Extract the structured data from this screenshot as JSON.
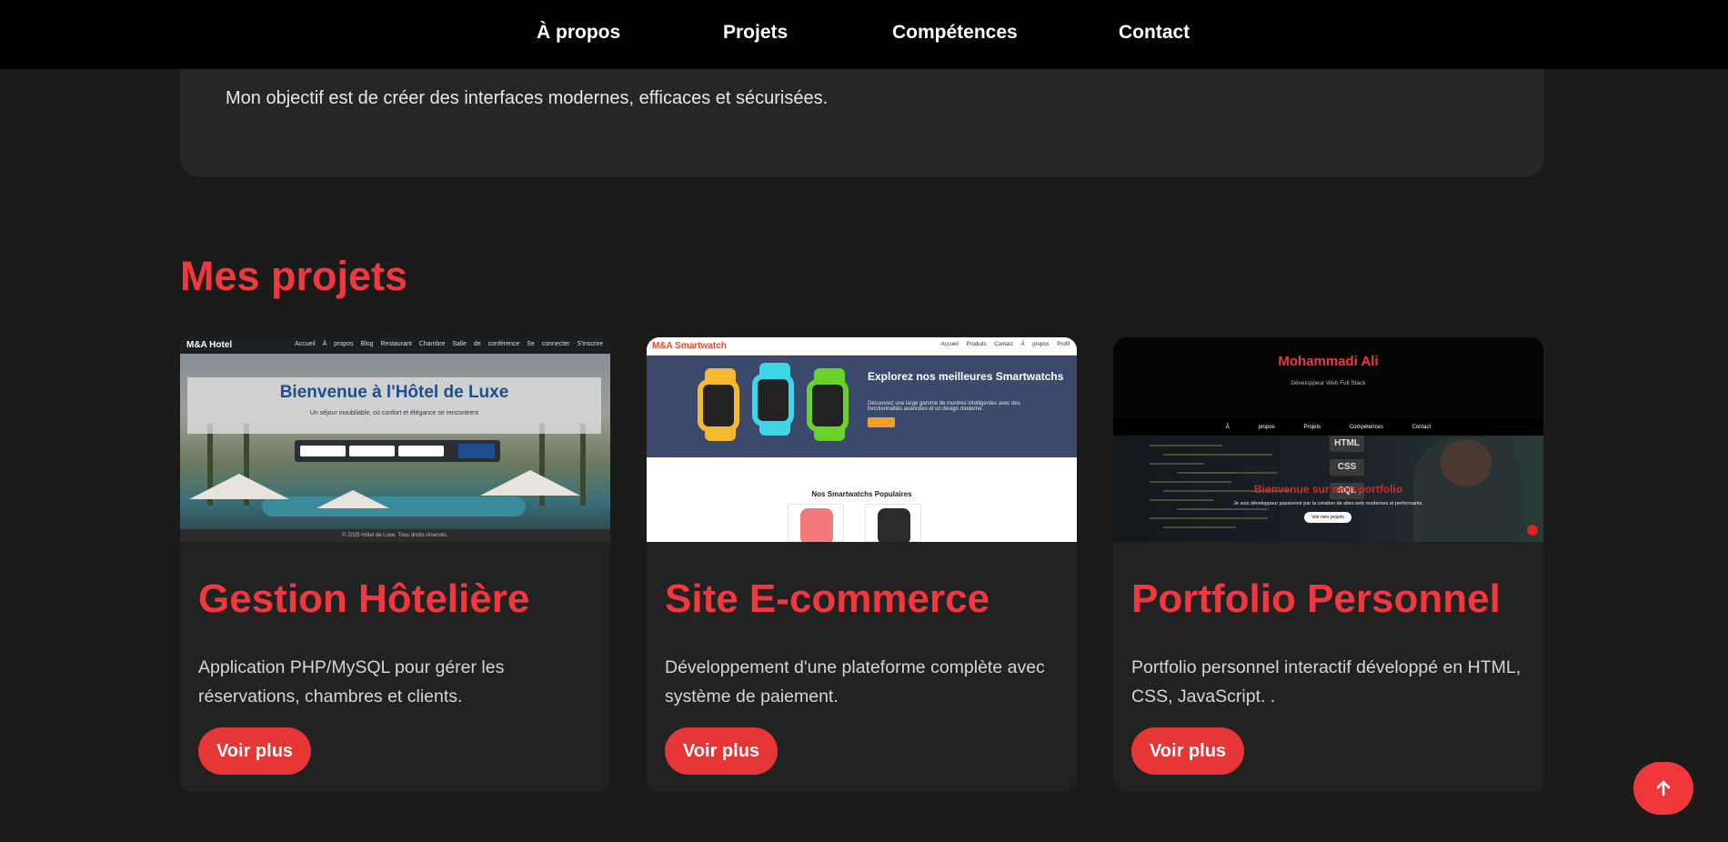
{
  "nav": {
    "items": [
      {
        "label": "À propos"
      },
      {
        "label": "Projets"
      },
      {
        "label": "Compétences"
      },
      {
        "label": "Contact"
      }
    ]
  },
  "about": {
    "text": "Mon objectif est de créer des interfaces modernes, efficaces et sécurisées."
  },
  "projects": {
    "title": "Mes projets",
    "items": [
      {
        "title": "Gestion Hôtelière",
        "description": "Application PHP/MySQL pour gérer les réservations, chambres et clients.",
        "button": "Voir plus",
        "preview": {
          "brand": "M&A Hotel",
          "links": "Accueil À propos Blog Restaurant Chambre Salle de conférence Se connecter S'inscrire",
          "hero_title": "Bienvenue à l'Hôtel de Luxe",
          "hero_subtitle": "Un séjour inoubliable, où confort et élégance se rencontrent",
          "footer": "© 2025 Hôtel de Luxe. Tous droits réservés."
        }
      },
      {
        "title": "Site E-commerce",
        "description": "Développement d'une plateforme complète avec système de paiement.",
        "button": "Voir plus",
        "preview": {
          "brand": "M&A Smartwatch",
          "links": "Accueil Produits Contact À propos Profil",
          "hero_title": "Explorez nos meilleures Smartwatchs",
          "hero_subtitle": "Découvrez une large gamme de montres intelligentes avec des fonctionnalités avancées et un design moderne.",
          "section_title": "Nos Smartwatchs Populaires"
        }
      },
      {
        "title": "Portfolio Personnel",
        "description": "Portfolio personnel interactif développé en HTML, CSS, JavaScript. .",
        "button": "Voir plus",
        "preview": {
          "name": "Mohammadi Ali",
          "role": "Développeur Web Full Stack",
          "links": "À propos Projets Compétences Contact",
          "tags": [
            "HTML",
            "CSS",
            "SQL"
          ],
          "hero_title": "Bienvenue sur mon portfolio",
          "hero_subtitle": "Je suis développeur passionné par la création de sites web modernes et performants.",
          "hero_button": "Voir mes projets"
        }
      }
    ]
  },
  "colors": {
    "accent": "#f2373f",
    "button": "#e63636",
    "background": "#1b1b1b",
    "card": "#222222"
  },
  "icons": {
    "scroll_top": "arrow-up-icon"
  }
}
